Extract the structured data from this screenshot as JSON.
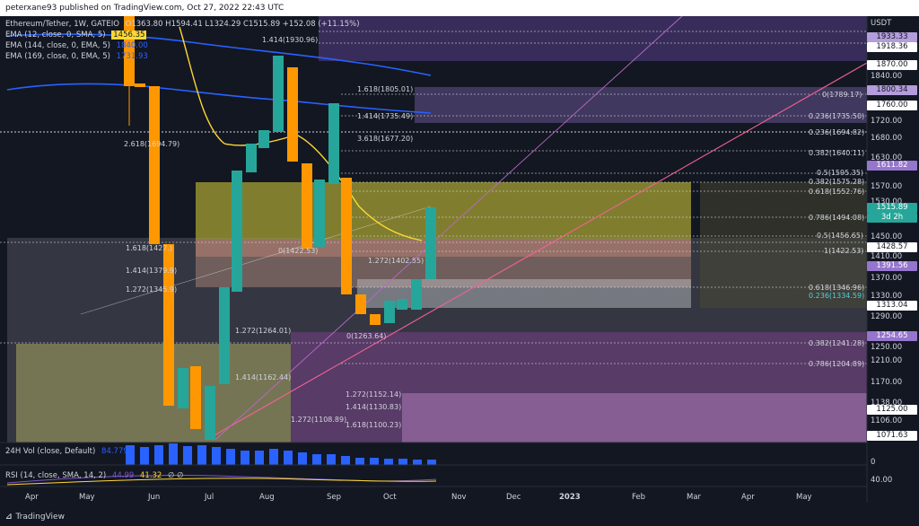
{
  "header": {
    "published": "peterxane93 published on TradingView.com, Oct 27, 2022 22:43 UTC"
  },
  "legend": {
    "symbol": "Ethereum/Tether, 1W, GATEIO",
    "ohlc": "O1363.80  H1594.41  L1324.29  C1515.89  +152.08 (+11.15%)",
    "ema12_label": "EMA (12, close, 0, SMA, 5)",
    "ema12_value": "1456.35",
    "ema144_label": "EMA (144, close, 0, EMA, 5)",
    "ema144_value": "1840.00",
    "ema169_label": "EMA (169, close, 0, EMA, 5)",
    "ema169_value": "1731.93"
  },
  "volume": {
    "label": "24H Vol (close, Default)",
    "value": "84.779M"
  },
  "rsi": {
    "label": "RSI (14, close, SMA, 14, 2)",
    "v1": "44.99",
    "v2": "41.32",
    "sym": "∅ ∅"
  },
  "axis": {
    "currency": "USDT",
    "ticks": [
      "1840.00",
      "1720.00",
      "1680.00",
      "1630.00",
      "1570.00",
      "1530.00",
      "1450.00",
      "1410.00",
      "1370.00",
      "1330.00",
      "1290.00",
      "1250.00",
      "1210.00",
      "1170.00",
      "1138.00",
      "1106.00",
      "0",
      "40.00"
    ],
    "price_tags": [
      {
        "text": "1933.33",
        "bg": "#b39ddb",
        "fg": "#131722"
      },
      {
        "text": "1918.36",
        "bg": "#ffffff",
        "fg": "#131722"
      },
      {
        "text": "1870.00",
        "bg": "#ffffff",
        "fg": "#131722"
      },
      {
        "text": "1800.34",
        "bg": "#b39ddb",
        "fg": "#131722"
      },
      {
        "text": "1760.00",
        "bg": "#ffffff",
        "fg": "#131722"
      },
      {
        "text": "1611.82",
        "bg": "#9575cd",
        "fg": "#ffffff"
      },
      {
        "text": "1515.89",
        "bg": "#26a69a",
        "fg": "#ffffff"
      },
      {
        "text": "3d 2h",
        "bg": "#26a69a",
        "fg": "#ffffff"
      },
      {
        "text": "1428.57",
        "bg": "#ffffff",
        "fg": "#131722"
      },
      {
        "text": "1391.56",
        "bg": "#9575cd",
        "fg": "#ffffff"
      },
      {
        "text": "1313.04",
        "bg": "#ffffff",
        "fg": "#131722"
      },
      {
        "text": "1254.65",
        "bg": "#9575cd",
        "fg": "#ffffff"
      },
      {
        "text": "1125.00",
        "bg": "#ffffff",
        "fg": "#131722"
      },
      {
        "text": "1071.63",
        "bg": "#ffffff",
        "fg": "#131722"
      }
    ]
  },
  "fib_labels": [
    {
      "text": "1.618(1805.01)",
      "c": "#d1d4dc"
    },
    {
      "text": "0(1789.17)",
      "c": "#d1d4dc"
    },
    {
      "text": "0.236(1735.50)",
      "c": "#d1d4dc"
    },
    {
      "text": "0.236(1694.82)",
      "c": "#d1d4dc"
    },
    {
      "text": "0.382(1640.11)",
      "c": "#d1d4dc"
    },
    {
      "text": "0.5(1595.35)",
      "c": "#d1d4dc"
    },
    {
      "text": "0.382(1575.28)",
      "c": "#d1d4dc"
    },
    {
      "text": "0.618(1552.76)",
      "c": "#d1d4dc"
    },
    {
      "text": "0.786(1494.08)",
      "c": "#d1d4dc"
    },
    {
      "text": "0.5(1456.65)",
      "c": "#d1d4dc"
    },
    {
      "text": "1(1422.53)",
      "c": "#d1d4dc"
    },
    {
      "text": "0.618(1346.96)",
      "c": "#d1d4dc"
    },
    {
      "text": "0.236(1334.59)",
      "c": "#4dd0e1"
    },
    {
      "text": "0.382(1241.28)",
      "c": "#d1d4dc"
    },
    {
      "text": "0.786(1204.89)",
      "c": "#d1d4dc"
    },
    {
      "text": "1.272(1152.14)",
      "c": "#d1d4dc"
    },
    {
      "text": "1.414(1130.83)",
      "c": "#d1d4dc"
    },
    {
      "text": "1.618(1100.23)",
      "c": "#d1d4dc"
    },
    {
      "text": "2.618(1694.79)",
      "c": "#d1d4dc"
    },
    {
      "text": "1.618(1427.)",
      "c": "#d1d4dc"
    },
    {
      "text": "1.414(1379.9)",
      "c": "#d1d4dc"
    },
    {
      "text": "1.272(1345.9)",
      "c": "#d1d4dc"
    },
    {
      "text": "1.272(1264.01)",
      "c": "#d1d4dc"
    },
    {
      "text": "1.414(1162.44)",
      "c": "#d1d4dc"
    },
    {
      "text": "1.272(1108.89)",
      "c": "#d1d4dc"
    },
    {
      "text": "0(1422.53)",
      "c": "#d1d4dc"
    },
    {
      "text": "1.272(1402.55)",
      "c": "#d1d4dc"
    },
    {
      "text": "0(1263.64)",
      "c": "#d1d4dc"
    },
    {
      "text": "3.618(1677.20)",
      "c": "#d1d4dc"
    },
    {
      "text": "1.414(1735.49)",
      "c": "#d1d4dc"
    },
    {
      "text": "1.414(1930.96)",
      "c": "#d1d4dc"
    }
  ],
  "time_axis": [
    "Apr",
    "May",
    "Jun",
    "Jul",
    "Aug",
    "Sep",
    "Oct",
    "Nov",
    "Dec",
    "2023",
    "Feb",
    "Mar",
    "Apr",
    "May"
  ],
  "footer": {
    "brand": "TradingView"
  }
}
